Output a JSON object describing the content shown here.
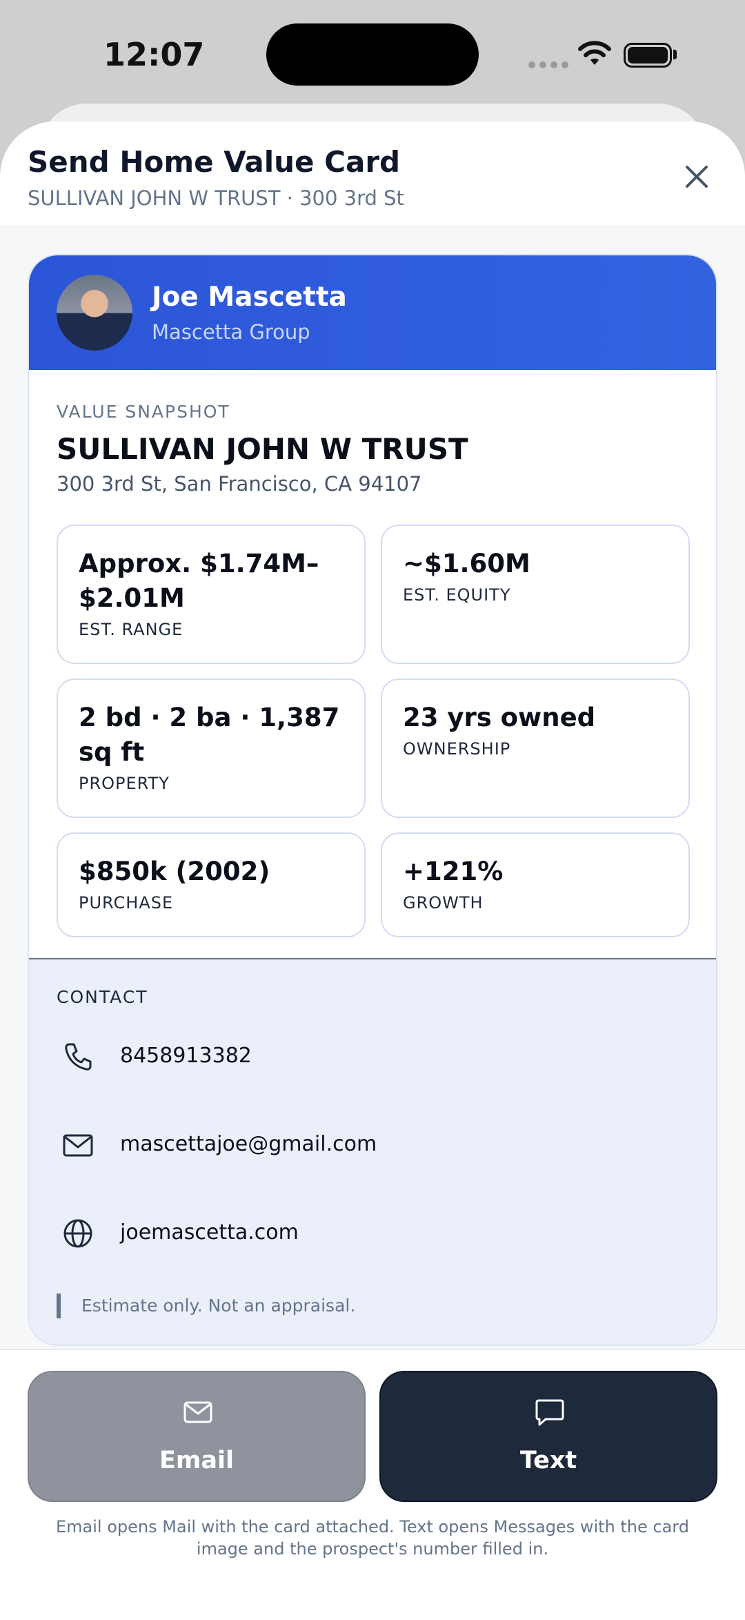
{
  "status_bar": {
    "time": "12:07"
  },
  "sheet": {
    "title": "Send Home Value Card",
    "subtitle": "SULLIVAN JOHN W TRUST · 300 3rd St"
  },
  "agent": {
    "name": "Joe Mascetta",
    "company": "Mascetta Group"
  },
  "snapshot": {
    "label": "VALUE SNAPSHOT",
    "owner": "SULLIVAN JOHN W TRUST",
    "address": "300 3rd St, San Francisco, CA 94107",
    "stats": [
      {
        "value": "Approx. $1.74M–$2.01M",
        "label": "EST. RANGE"
      },
      {
        "value": "~$1.60M",
        "label": "EST. EQUITY"
      },
      {
        "value": "2 bd · 2 ba · 1,387 sq ft",
        "label": "PROPERTY"
      },
      {
        "value": "23 yrs owned",
        "label": "OWNERSHIP"
      },
      {
        "value": "$850k (2002)",
        "label": "PURCHASE"
      },
      {
        "value": "+121%",
        "label": "GROWTH"
      }
    ]
  },
  "contact": {
    "label": "CONTACT",
    "phone": "8458913382",
    "email": "mascettajoe@gmail.com",
    "website": "joemascetta.com",
    "disclaimer": "Estimate only. Not an appraisal."
  },
  "actions": {
    "email_label": "Email",
    "text_label": "Text",
    "footnote": "Email opens Mail with the card attached. Text opens Messages with the card image and the prospect's number filled in."
  },
  "colors": {
    "accent": "#2b55d8",
    "text_button": "#1e293b",
    "email_button": "#8e939d",
    "contact_bg": "#eaeffa"
  },
  "icons": {
    "close": "close-icon",
    "phone": "phone-icon",
    "mail": "mail-icon",
    "globe": "globe-icon",
    "message": "message-icon"
  }
}
